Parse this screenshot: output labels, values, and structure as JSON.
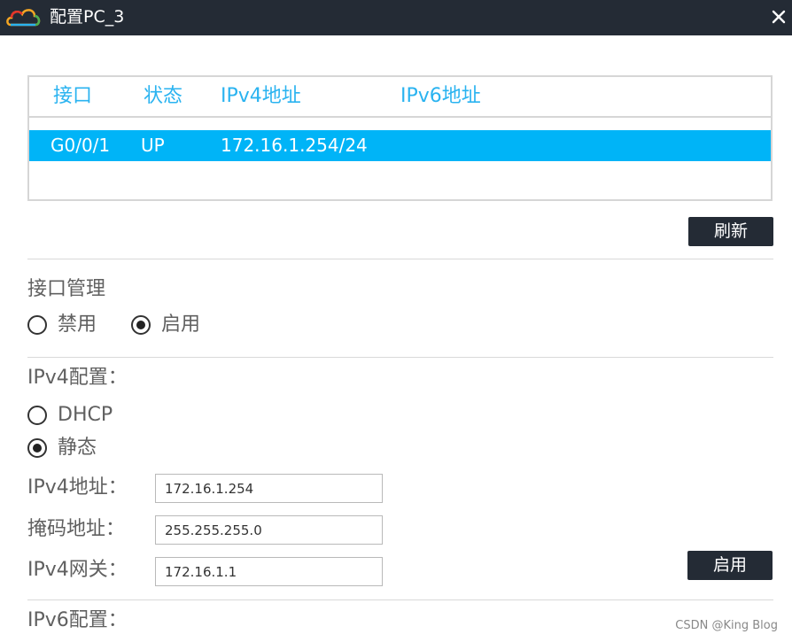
{
  "window": {
    "title": "配置PC_3",
    "logo_icon": "cloud-logo-icon",
    "close_icon": "close-icon"
  },
  "colors": {
    "titlebar": "#242b35",
    "header_text": "#2ab3f0",
    "selected_row": "#00b4f7",
    "button": "#242b35"
  },
  "interface_table": {
    "columns": [
      "接口",
      "状态",
      "IPv4地址",
      "IPv6地址"
    ],
    "rows": [
      {
        "interface": "G0/0/1",
        "status": "UP",
        "ipv4": "172.16.1.254/24",
        "ipv6": ""
      }
    ]
  },
  "refresh_button": "刷新",
  "interface_management": {
    "label": "接口管理",
    "options": [
      {
        "label": "禁用",
        "selected": false
      },
      {
        "label": "启用",
        "selected": true
      }
    ]
  },
  "ipv4_config": {
    "label": "IPv4配置：",
    "modes": [
      {
        "label": "DHCP",
        "selected": false
      },
      {
        "label": "静态",
        "selected": true
      }
    ],
    "address_label": "IPv4地址：",
    "address_value": "172.16.1.254",
    "mask_label": "掩码地址：",
    "mask_value": "255.255.255.0",
    "gateway_label": "IPv4网关：",
    "gateway_value": "172.16.1.1",
    "apply_button": "启用"
  },
  "ipv6_config": {
    "label": "IPv6配置："
  },
  "watermark": "CSDN @King Blog"
}
